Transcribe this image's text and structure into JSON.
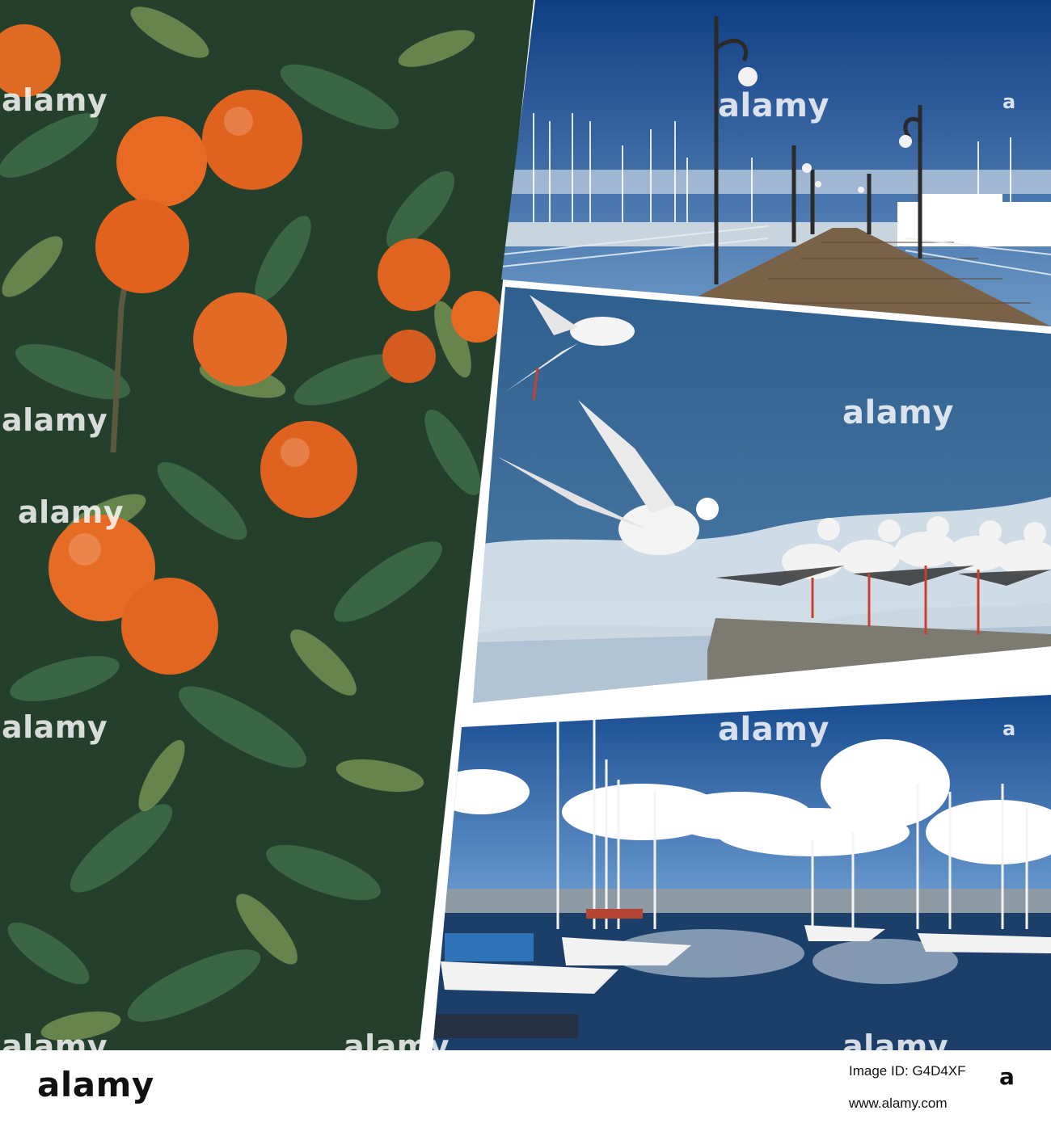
{
  "watermark": {
    "brand": "alamy",
    "mark": "a"
  },
  "footer": {
    "brand": "alamy",
    "mark": "a",
    "image_id": "Image ID: G4D4XF",
    "url": "www.alamy.com"
  },
  "colors": {
    "sky": "#1f4e8a",
    "sea": "#3f6f99",
    "orange": "#e0621f",
    "leaf": "#3c6a45",
    "deck": "#7a6248"
  }
}
